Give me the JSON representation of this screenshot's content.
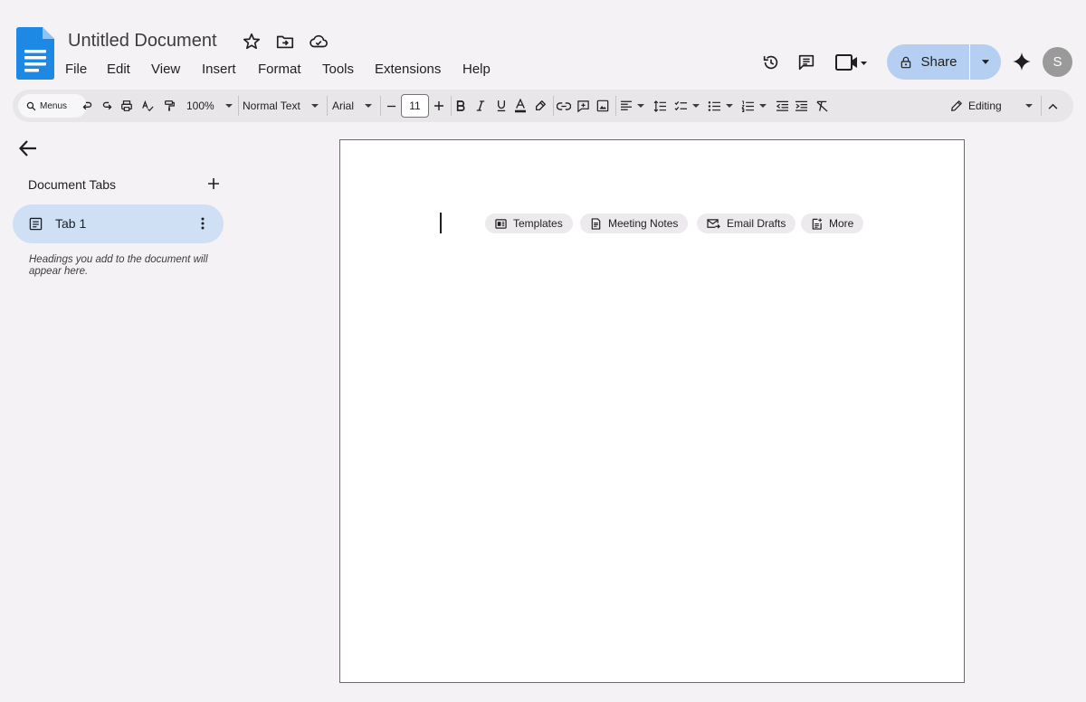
{
  "app": {
    "doc_title": "Untitled Document",
    "user_initial": "S"
  },
  "menu": {
    "items": [
      "File",
      "Edit",
      "View",
      "Insert",
      "Format",
      "Tools",
      "Extensions",
      "Help"
    ]
  },
  "header": {
    "share_label": "Share"
  },
  "toolbar": {
    "search_label": "Menus",
    "zoom": "100%",
    "style": "Normal Text",
    "font": "Arial",
    "font_size": "11",
    "mode": "Editing"
  },
  "sidebar": {
    "title": "Document Tabs",
    "tabs": [
      {
        "label": "Tab 1"
      }
    ],
    "hint": "Headings you add to the document will appear here."
  },
  "page": {
    "chips": [
      {
        "label": "Templates",
        "icon": "template-icon"
      },
      {
        "label": "Meeting Notes",
        "icon": "meeting-notes-icon"
      },
      {
        "label": "Email Drafts",
        "icon": "email-drafts-icon"
      },
      {
        "label": "More",
        "icon": "more-doc-icon"
      }
    ]
  },
  "colors": {
    "brand_blue": "#1e88e5",
    "share_bg": "#b5cff3",
    "selected_tab_bg": "#cfe0f5",
    "background": "#f4f2f4"
  }
}
